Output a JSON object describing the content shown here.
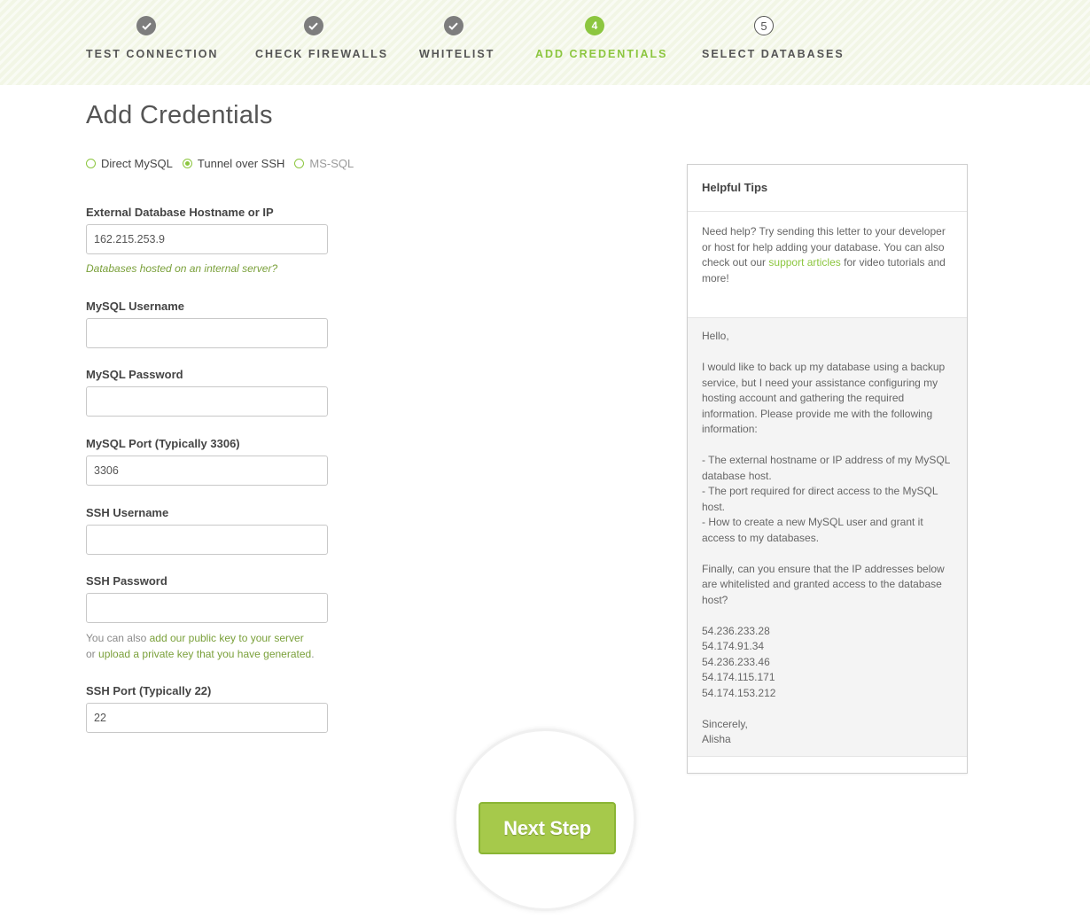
{
  "stepper": {
    "steps": [
      {
        "label": "TEST CONNECTION",
        "icon": "checkmark-icon",
        "state": "done"
      },
      {
        "label": "CHECK FIREWALLS",
        "icon": "checkmark-icon",
        "state": "done"
      },
      {
        "label": "WHITELIST",
        "icon": "checkmark-icon",
        "state": "done"
      },
      {
        "label": "ADD CREDENTIALS",
        "number": "4",
        "state": "active"
      },
      {
        "label": "SELECT DATABASES",
        "number": "5",
        "state": "todo"
      }
    ]
  },
  "page_title": "Add Credentials",
  "connection_type": {
    "options": [
      "Direct MySQL",
      "Tunnel over SSH",
      "MS-SQL"
    ],
    "selected": "Tunnel over SSH"
  },
  "form": {
    "hostname_label": "External Database Hostname or IP",
    "hostname_value": "162.215.253.9",
    "internal_server_link": "Databases hosted on an internal server?",
    "mysql_username_label": "MySQL Username",
    "mysql_password_label": "MySQL Password",
    "mysql_port_label": "MySQL Port (Typically 3306)",
    "mysql_port_value": "3306",
    "ssh_username_label": "SSH Username",
    "ssh_password_label": "SSH Password",
    "key_hint_prefix": "You can also",
    "key_hint_link1": "add our public key to your server",
    "key_hint_mid": "or",
    "key_hint_link2": "upload a private key that you have generated",
    "key_hint_suffix": ".",
    "ssh_port_label": "SSH Port (Typically 22)",
    "ssh_port_value": "22"
  },
  "tips": {
    "title": "Helpful Tips",
    "intro_before_link": "Need help? Try sending this letter to your developer or host for help adding your database. You can also check out our",
    "intro_link": "support articles",
    "intro_after_link": "for video tutorials and more!",
    "letter": {
      "greeting": "Hello,",
      "body": "I would like to back up my database using a backup service, but I need your assistance configuring my hosting account and gathering the required information. Please provide me with the following information:",
      "bullet1": "- The external hostname or IP address of my MySQL database host.",
      "bullet2": "- The port required for direct access to the MySQL host.",
      "bullet3": "- How to create a new MySQL user and grant it access to my databases.",
      "closing_request": "Finally, can you ensure that the IP addresses below are whitelisted and granted access to the database host?",
      "ips": [
        "54.236.233.28",
        "54.174.91.34",
        "54.236.233.46",
        "54.174.115.171",
        "54.174.153.212"
      ],
      "signoff": "Sincerely,",
      "signature": "Alisha"
    }
  },
  "next_button": "Next Step",
  "colors": {
    "accent": "#8cc63f",
    "button": "#a6c94b",
    "done_step": "#7d7d7d"
  }
}
